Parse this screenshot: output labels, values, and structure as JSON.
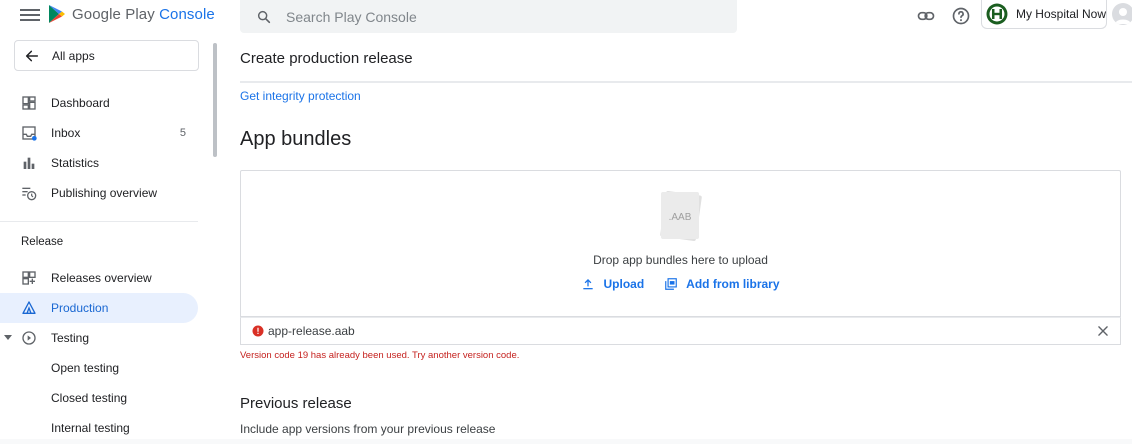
{
  "header": {
    "brand_part1": "Google Play",
    "brand_part2": "Console",
    "search_placeholder": "Search Play Console",
    "developer_name": "My Hospital Now"
  },
  "sidebar": {
    "all_apps_label": "All apps",
    "items": [
      {
        "label": "Dashboard",
        "icon": "dashboard-icon"
      },
      {
        "label": "Inbox",
        "icon": "inbox-icon",
        "count": "5"
      },
      {
        "label": "Statistics",
        "icon": "bar-chart-icon"
      },
      {
        "label": "Publishing overview",
        "icon": "publishing-icon"
      }
    ],
    "section_release": "Release",
    "release_items": [
      {
        "label": "Releases overview",
        "icon": "releases-overview-icon"
      },
      {
        "label": "Production",
        "icon": "production-icon",
        "active": true
      },
      {
        "label": "Testing",
        "icon": "testing-icon",
        "expanded": true
      },
      {
        "label": "Open testing"
      },
      {
        "label": "Closed testing"
      },
      {
        "label": "Internal testing"
      }
    ]
  },
  "main": {
    "page_title": "Create production release",
    "integrity_link": "Get integrity protection",
    "bundles_title": "App bundles",
    "aab_label": ".AAB",
    "drop_text": "Drop app bundles here to upload",
    "upload_label": "Upload",
    "library_label": "Add from library",
    "file_name": "app-release.aab",
    "error_message": "Version code 19 has already been used. Try another version code.",
    "previous_release_title": "Previous release",
    "previous_release_desc": "Include app versions from your previous release"
  },
  "colors": {
    "accent": "#1a73e8",
    "active_bg": "#e8f0fe",
    "error": "#c5221f",
    "border": "#dadce0"
  }
}
